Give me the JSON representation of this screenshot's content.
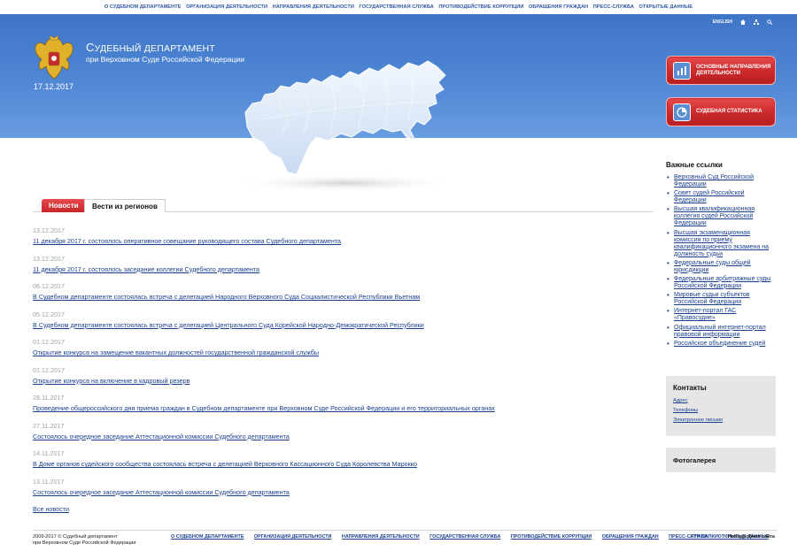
{
  "topnav": [
    "О Судебном департаменте",
    "Организация деятельности",
    "Направления деятельности",
    "Государственная служба",
    "Противодействие коррупции",
    "Обращения граждан",
    "Пресс-служба",
    "Открытые данные"
  ],
  "header": {
    "title_line1_cap": "С",
    "title_line1_rest": "УДЕБНЫЙ ДЕПАРТАМЕНТ",
    "title_line2": "при Верховном Суде Российской Федерации",
    "date": "17.12.2017",
    "lang": "ENGLISH",
    "buttons": [
      {
        "label": "Основные направления деятельности"
      },
      {
        "label": "Судебная статистика"
      }
    ]
  },
  "tabs": {
    "news": "Новости",
    "regions": "Вести из регионов"
  },
  "news": [
    {
      "date": "13.12.2017",
      "title": "11 декабря 2017 г. состоялось оперативное совещание руководящего состава Судебного департамента"
    },
    {
      "date": "13.12.2017",
      "title": "11 декабря 2017 г. состоялось заседание коллегии Судебного департамента"
    },
    {
      "date": "06.12.2017",
      "title": "В Судебном департаменте состоялась встреча с делегацией Народного Верховного Суда Социалистической Республики Вьетнам"
    },
    {
      "date": "05.12.2017",
      "title": "В Судебном департаменте состоялась встреча с делегацией Центрального Суда Корейской Народно-Демократической Республики"
    },
    {
      "date": "01.12.2017",
      "title": "Открытие конкурса на замещение вакантных должностей государственной гражданской службы"
    },
    {
      "date": "01.12.2017",
      "title": "Открытие конкурса на включение в кадровый резерв"
    },
    {
      "date": "28.11.2017",
      "title": "Проведение общероссийского дня приема граждан в Судебном департаменте при Верховном Суде Российской Федерации и его территориальных органах"
    },
    {
      "date": "27.11.2017",
      "title": "Состоялось очередное заседание Аттестационной комиссии Судебного департамента"
    },
    {
      "date": "14.11.2017",
      "title": "В Доме органов судейского сообщества состоялась встреча с делегацией Верховного Кассационного Суда Королевства Марокко"
    },
    {
      "date": "13.11.2017",
      "title": "Состоялось очередное заседание Аттестационной комиссии Судебного департамента"
    }
  ],
  "all_news": "Все новости",
  "important_links": {
    "title": "Важные ссылки",
    "items": [
      "Верховный Суд Российской Федерации",
      "Совет судей Российской Федерации",
      "Высшая квалификационная коллегия судей Российской Федерации",
      "Высшая экзаменационная комиссия по приему квалификационного экзамена на должность судьи",
      "Федеральные суды общей юрисдикции",
      "Федеральные арбитражные суды Российской Федерации",
      "Мировые судьи субъектов Российской Федерации",
      "Интернет-портал ГАС «Правосудие»",
      "Официальный интернет-портал правовой информации",
      "Российское объединение судей"
    ]
  },
  "contacts": {
    "title": "Контакты",
    "items": [
      "Адрес",
      "Телефоны",
      "Электронное письмо"
    ]
  },
  "gallery": {
    "title": "Фотогалерея"
  },
  "footer": {
    "copyright_line1": "2009-2017 © Судебный департамент",
    "copyright_line2": "при Верховном Суде Российской Федерации",
    "nav": [
      "О Судебном департаменте",
      "Организация деятельности",
      "Направления деятельности",
      "Государственная служба",
      "Противодействие коррупции",
      "Обращения граждан",
      "Пресс-служба",
      "Открытые данные"
    ],
    "ftp": "FTP-ПАПКИ",
    "sitemap": "Новодробная сайта"
  },
  "colors": {
    "header_blue": "#4a82d1",
    "accent_red": "#c8272a",
    "link_blue": "#1a3f8f"
  }
}
